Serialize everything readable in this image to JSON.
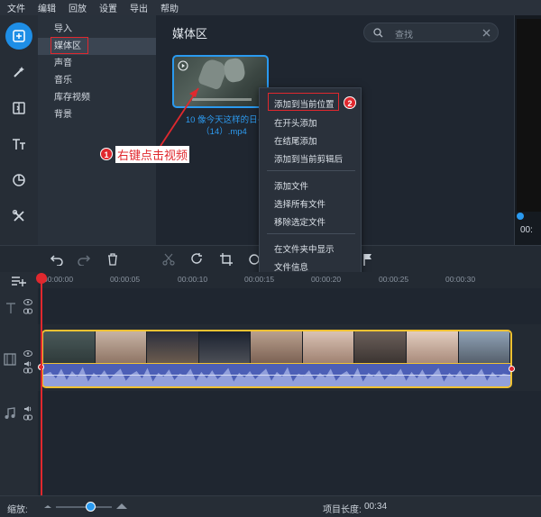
{
  "menu": [
    "文件",
    "编辑",
    "回放",
    "设置",
    "导出",
    "帮助"
  ],
  "sidebar": {
    "items": [
      {
        "label": "导入"
      },
      {
        "label": "媒体区"
      },
      {
        "label": "声音"
      },
      {
        "label": "音乐"
      },
      {
        "label": "库存视频"
      },
      {
        "label": "背景"
      }
    ],
    "selected_index": 1
  },
  "media": {
    "title": "媒体区",
    "search_placeholder": "查找",
    "clip": {
      "label_line1": "10 像今天这样的日~",
      "label_line2": "（14）.mp4"
    }
  },
  "context_menu": {
    "items": [
      "添加到当前位置",
      "在开头添加",
      "在结尾添加",
      "添加到当前剪辑后",
      "添加文件",
      "选择所有文件",
      "移除选定文件",
      "在文件夹中显示",
      "文件信息"
    ]
  },
  "annotations": {
    "step1_number": "1",
    "step1_text": "右键点击视频",
    "step2_number": "2"
  },
  "preview": {
    "time": "00:"
  },
  "ruler": {
    "ticks": [
      "00:00:00",
      "00:00:05",
      "00:00:10",
      "00:00:15",
      "00:00:20",
      "00:00:25",
      "00:00:30"
    ]
  },
  "status": {
    "zoom_label": "缩放:",
    "zoom_level": 0.62,
    "project_length_label": "项目长度:",
    "project_length": "00:34"
  },
  "colors": {
    "accent": "#1e8ee6",
    "annotation": "#e0282e",
    "clip_border": "#f1c232",
    "audio": "#4c5fb6"
  },
  "icons": [
    "add-media-icon",
    "magic-wand-icon",
    "transition-icon",
    "text-icon",
    "sticker-icon",
    "tools-icon",
    "undo-icon",
    "redo-icon",
    "delete-icon",
    "cut-icon",
    "rotate-icon",
    "crop-icon",
    "flag-icon",
    "search-icon",
    "clear-icon",
    "play-icon",
    "eye-icon",
    "link-icon",
    "speaker-icon",
    "music-icon",
    "film-icon",
    "text-track-icon",
    "add-track-icon"
  ]
}
